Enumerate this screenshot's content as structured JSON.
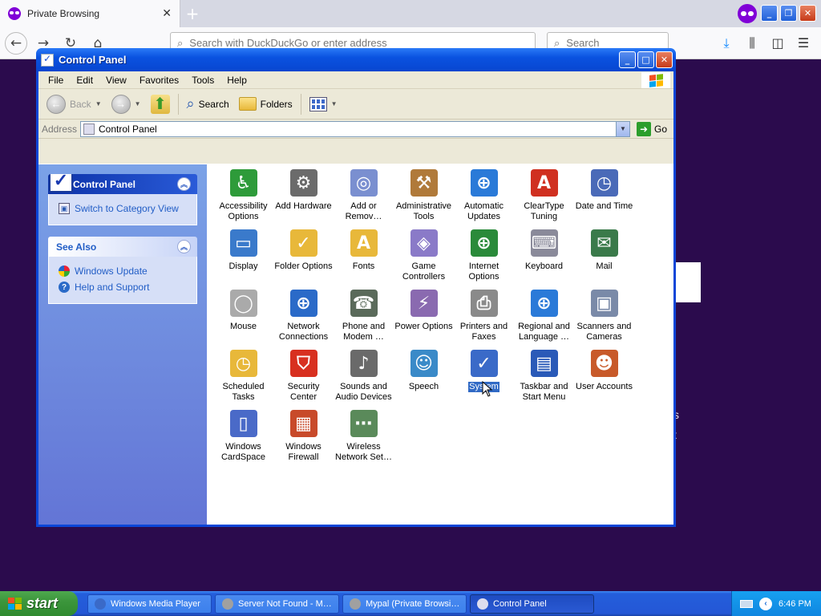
{
  "browser": {
    "tab_title": "Private Browsing",
    "url_placeholder": "Search with DuckDuckGo or enter address",
    "search_placeholder": "Search"
  },
  "window": {
    "title": "Control Panel",
    "menu": [
      "File",
      "Edit",
      "View",
      "Favorites",
      "Tools",
      "Help"
    ],
    "toolbar": {
      "back": "Back",
      "search": "Search",
      "folders": "Folders"
    },
    "address_label": "Address",
    "address_value": "Control Panel",
    "go_label": "Go"
  },
  "sidebar": {
    "control_panel": {
      "title": "Control Panel",
      "link": "Switch to Category View"
    },
    "see_also": {
      "title": "See Also",
      "links": [
        "Windows Update",
        "Help and Support"
      ]
    }
  },
  "items": [
    {
      "label": "Accessibility\nOptions",
      "color": "#2e9b3a",
      "glyph": "♿"
    },
    {
      "label": "Add Hardware",
      "color": "#6b6b6b",
      "glyph": "⚙"
    },
    {
      "label": "Add or\nRemov…",
      "color": "#7a8fd0",
      "glyph": "◎"
    },
    {
      "label": "Administrative\nTools",
      "color": "#b07a3a",
      "glyph": "⚒"
    },
    {
      "label": "Automatic\nUpdates",
      "color": "#2a7ad8",
      "glyph": "⊕"
    },
    {
      "label": "ClearType\nTuning",
      "color": "#d03020",
      "glyph": "A"
    },
    {
      "label": "Date and Time",
      "color": "#4a6ab8",
      "glyph": "◷"
    },
    {
      "label": "Display",
      "color": "#3a7acb",
      "glyph": "▭"
    },
    {
      "label": "Folder Options",
      "color": "#e8b83a",
      "glyph": "✓"
    },
    {
      "label": "Fonts",
      "color": "#e8b83a",
      "glyph": "A"
    },
    {
      "label": "Game\nControllers",
      "color": "#8a7ac8",
      "glyph": "◈"
    },
    {
      "label": "Internet\nOptions",
      "color": "#2a8a3a",
      "glyph": "⊕"
    },
    {
      "label": "Keyboard",
      "color": "#8a8a9a",
      "glyph": "⌨"
    },
    {
      "label": "Mail",
      "color": "#3a7a4a",
      "glyph": "✉"
    },
    {
      "label": "Mouse",
      "color": "#aaaaaa",
      "glyph": "◯"
    },
    {
      "label": "Network\nConnections",
      "color": "#2a6ac8",
      "glyph": "⊕"
    },
    {
      "label": "Phone and\nModem …",
      "color": "#5a6a5a",
      "glyph": "☎"
    },
    {
      "label": "Power Options",
      "color": "#8a6ab0",
      "glyph": "⚡"
    },
    {
      "label": "Printers and\nFaxes",
      "color": "#8a8a8a",
      "glyph": "⎙"
    },
    {
      "label": "Regional and\nLanguage …",
      "color": "#2a7ad8",
      "glyph": "⊕"
    },
    {
      "label": "Scanners and\nCameras",
      "color": "#7a8aa8",
      "glyph": "▣"
    },
    {
      "label": "Scheduled\nTasks",
      "color": "#e8b83a",
      "glyph": "◷"
    },
    {
      "label": "Security\nCenter",
      "color": "#d83020",
      "glyph": "⛉"
    },
    {
      "label": "Sounds and\nAudio Devices",
      "color": "#6a6a6a",
      "glyph": "♪"
    },
    {
      "label": "Speech",
      "color": "#3a8ac8",
      "glyph": "☺"
    },
    {
      "label": "System",
      "color": "#3a6ac8",
      "glyph": "✓",
      "selected": true
    },
    {
      "label": "Taskbar and\nStart Menu",
      "color": "#2a5ab8",
      "glyph": "▤"
    },
    {
      "label": "User Accounts",
      "color": "#c85a2a",
      "glyph": "☻"
    },
    {
      "label": "Windows\nCardSpace",
      "color": "#4a6ac8",
      "glyph": "▯"
    },
    {
      "label": "Windows\nFirewall",
      "color": "#c84a2a",
      "glyph": "▦"
    },
    {
      "label": "Wireless\nNetwork Set…",
      "color": "#5a8a5a",
      "glyph": "⋯"
    }
  ],
  "background": {
    "text1": "s",
    "text2": "t"
  },
  "taskbar": {
    "start_label": "start",
    "tasks": [
      "Windows Media Player",
      "Server Not Found - M…",
      "Mypal (Private Browsi…",
      "Control Panel"
    ],
    "clock": "6:46 PM"
  },
  "colors": {
    "xp_blue": "#0a46d8",
    "selection": "#316ac5",
    "private_purple": "#8000d7"
  }
}
